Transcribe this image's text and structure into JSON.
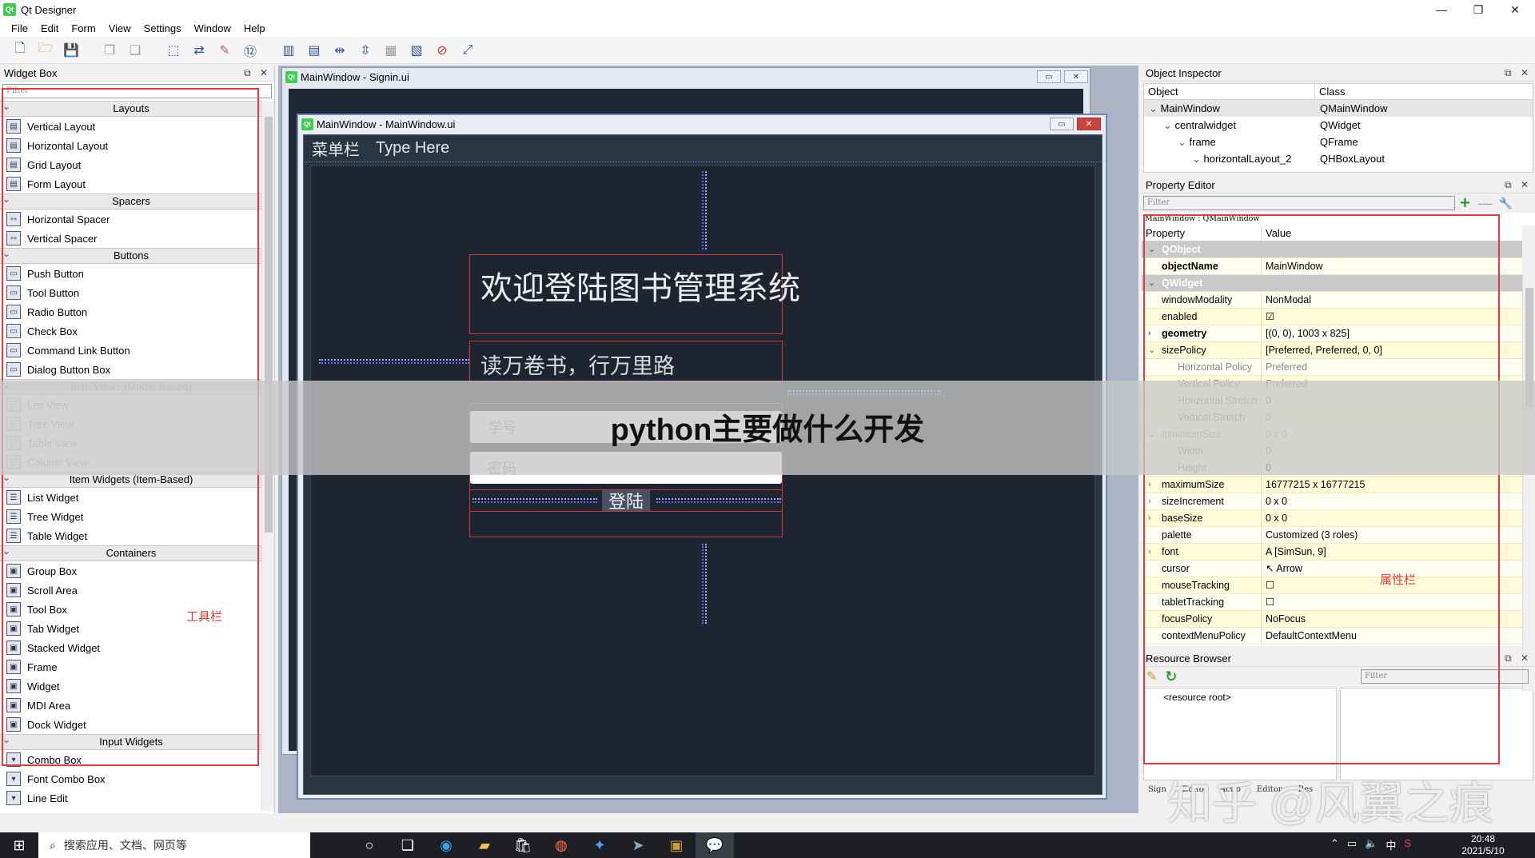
{
  "window": {
    "title": "Qt Designer"
  },
  "menu": [
    "File",
    "Edit",
    "Form",
    "View",
    "Settings",
    "Window",
    "Help"
  ],
  "widget_box": {
    "title": "Widget Box",
    "filter_placeholder": "Filter",
    "categories": [
      {
        "name": "Layouts",
        "disabled": false,
        "items": [
          "Vertical Layout",
          "Horizontal Layout",
          "Grid Layout",
          "Form Layout"
        ]
      },
      {
        "name": "Spacers",
        "disabled": false,
        "items": [
          "Horizontal Spacer",
          "Vertical Spacer"
        ]
      },
      {
        "name": "Buttons",
        "disabled": false,
        "items": [
          "Push Button",
          "Tool Button",
          "Radio Button",
          "Check Box",
          "Command Link Button",
          "Dialog Button Box"
        ]
      },
      {
        "name": "Item Views (Model-Based)",
        "disabled": true,
        "items": [
          "List View",
          "Tree View",
          "Table View",
          "Column View"
        ]
      },
      {
        "name": "Item Widgets (Item-Based)",
        "disabled": false,
        "items": [
          "List Widget",
          "Tree Widget",
          "Table Widget"
        ]
      },
      {
        "name": "Containers",
        "disabled": false,
        "items": [
          "Group Box",
          "Scroll Area",
          "Tool Box",
          "Tab Widget",
          "Stacked Widget",
          "Frame",
          "Widget",
          "MDI Area",
          "Dock Widget"
        ]
      },
      {
        "name": "Input Widgets",
        "disabled": false,
        "items": [
          "Combo Box",
          "Font Combo Box",
          "Line Edit"
        ]
      }
    ],
    "annotation": "工具栏"
  },
  "mdi": {
    "back_window_title": "MainWindow - Signin.ui",
    "front_window_title": "MainWindow - MainWindow.ui",
    "form_menu": [
      "菜单栏",
      "Type Here"
    ],
    "welcome_title": "欢迎登陆图书管理系统",
    "subtitle": "读万卷书，行万里路",
    "student_id_placeholder": "学号",
    "password_placeholder": "密码",
    "login_label": "登陆"
  },
  "object_inspector": {
    "title": "Object Inspector",
    "columns": [
      "Object",
      "Class"
    ],
    "rows": [
      {
        "object": "MainWindow",
        "class": "QMainWindow",
        "level": 0
      },
      {
        "object": "centralwidget",
        "class": "QWidget",
        "level": 1
      },
      {
        "object": "frame",
        "class": "QFrame",
        "level": 2
      },
      {
        "object": "horizontalLayout_2",
        "class": "QHBoxLayout",
        "level": 3
      }
    ]
  },
  "property_editor": {
    "title": "Property Editor",
    "filter_placeholder": "Filter",
    "context": "MainWindow : QMainWindow",
    "columns": [
      "Property",
      "Value"
    ],
    "rows": [
      {
        "p": "QObject",
        "v": "",
        "kind": "group"
      },
      {
        "p": "objectName",
        "v": "MainWindow",
        "kind": "bold"
      },
      {
        "p": "QWidget",
        "v": "",
        "kind": "group"
      },
      {
        "p": "windowModality",
        "v": "NonModal",
        "kind": "normal"
      },
      {
        "p": "enabled",
        "v": "☑",
        "kind": "check"
      },
      {
        "p": "geometry",
        "v": "[(0, 0), 1003 x 825]",
        "kind": "bold"
      },
      {
        "p": "sizePolicy",
        "v": "[Preferred, Preferred, 0, 0]",
        "kind": "normal"
      },
      {
        "p": "Horizontal Policy",
        "v": "Preferred",
        "kind": "sub"
      },
      {
        "p": "Vertical Policy",
        "v": "Preferred",
        "kind": "sub"
      },
      {
        "p": "Horizontal Stretch",
        "v": "0",
        "kind": "sub"
      },
      {
        "p": "Vertical Stretch",
        "v": "0",
        "kind": "sub"
      },
      {
        "p": "minimumSize",
        "v": "0 x 0",
        "kind": "dim"
      },
      {
        "p": "Width",
        "v": "0",
        "kind": "sub"
      },
      {
        "p": "Height",
        "v": "0",
        "kind": "subdark"
      },
      {
        "p": "maximumSize",
        "v": "16777215 x 16777215",
        "kind": "normal"
      },
      {
        "p": "sizeIncrement",
        "v": "0 x 0",
        "kind": "normal"
      },
      {
        "p": "baseSize",
        "v": "0 x 0",
        "kind": "normal"
      },
      {
        "p": "palette",
        "v": "Customized (3 roles)",
        "kind": "normal"
      },
      {
        "p": "font",
        "v": "A  [SimSun, 9]",
        "kind": "normal"
      },
      {
        "p": "cursor",
        "v": "↖  Arrow",
        "kind": "normal"
      },
      {
        "p": "mouseTracking",
        "v": "☐",
        "kind": "check"
      },
      {
        "p": "tabletTracking",
        "v": "☐",
        "kind": "check"
      },
      {
        "p": "focusPolicy",
        "v": "NoFocus",
        "kind": "normal"
      },
      {
        "p": "contextMenuPolicy",
        "v": "DefaultContextMenu",
        "kind": "normal"
      }
    ],
    "annotation": "属性栏"
  },
  "resource_browser": {
    "title": "Resource Browser",
    "filter_placeholder": "Filter",
    "root": "<resource root>",
    "tabs": [
      "Sign",
      "Edito",
      "Actio",
      "Editor",
      "Res"
    ]
  },
  "taskbar": {
    "search_placeholder": "搜索应用、文档、网页等",
    "time": "20:48",
    "date": "2021/5/10",
    "ime": "中"
  },
  "overlay": {
    "headline": "python主要做什么开发",
    "watermark": "知乎 @风翼之痕"
  },
  "colors": {
    "annotation_red": "#e23b3b",
    "form_bg": "#1e2531",
    "qt_green": "#41cd52"
  }
}
